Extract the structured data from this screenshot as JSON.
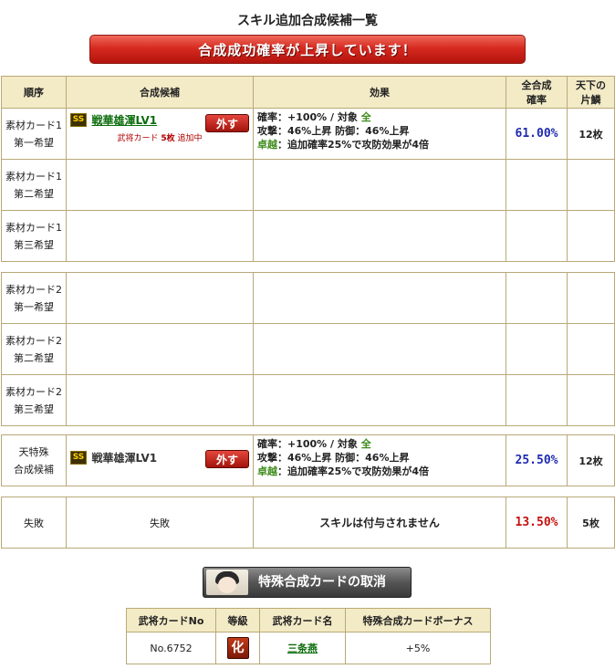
{
  "page_title": "スキル追加合成候補一覧",
  "banner": "合成成功確率が上昇しています！",
  "headers": {
    "order": "順序",
    "candidate": "合成候補",
    "effect": "効果",
    "total_rate": [
      "全合成",
      "確率"
    ],
    "count": [
      "天下の",
      "片鱗"
    ]
  },
  "group1": [
    {
      "order": [
        "素材カード1",
        "第一希望"
      ],
      "ss_badge": "SS",
      "skill_name": "戦華雄渾LV1",
      "remove_label": "外す",
      "note_prefix": "武将カード",
      "note_count": "5枚",
      "note_suffix": "追加中",
      "effect": {
        "line1_prefix": "確率：+100% / 対象",
        "line1_target": "全",
        "line2": "攻撃：46%上昇 防御：46%上昇",
        "line3_label": "卓越",
        "line3_text": "：追加確率25%で攻防効果が4倍"
      },
      "rate": "61.00%",
      "count": "12枚"
    },
    {
      "order": [
        "素材カード1",
        "第二希望"
      ]
    },
    {
      "order": [
        "素材カード1",
        "第三希望"
      ]
    }
  ],
  "group2": [
    {
      "order": [
        "素材カード2",
        "第一希望"
      ]
    },
    {
      "order": [
        "素材カード2",
        "第二希望"
      ]
    },
    {
      "order": [
        "素材カード2",
        "第三希望"
      ]
    }
  ],
  "tentokushu": {
    "order": [
      "天特殊",
      "合成候補"
    ],
    "ss_badge": "SS",
    "skill_name": "戦華雄渾LV1",
    "remove_label": "外す",
    "effect": {
      "line1_prefix": "確率：+100% / 対象",
      "line1_target": "全",
      "line2": "攻撃：46%上昇 防御：46%上昇",
      "line3_label": "卓越",
      "line3_text": "：追加確率25%で攻防効果が4倍"
    },
    "rate": "25.50%",
    "count": "12枚"
  },
  "failure": {
    "order": "失敗",
    "candidate": "失敗",
    "effect": "スキルは付与されません",
    "rate": "13.50%",
    "count": "5枚"
  },
  "cancel_button": "特殊合成カードの取消",
  "special_table": {
    "headers": [
      "武将カードNo",
      "等級",
      "武将カード名",
      "特殊合成カードボーナス"
    ],
    "row": {
      "no": "No.6752",
      "rank": "化",
      "name": "三条燕",
      "bonus": "+5%"
    }
  },
  "colors": {
    "banner_red": "#d62a20",
    "rate_blue": "#1f2bb0",
    "rate_red": "#c41010",
    "header_bg": "#f3ebc6",
    "border": "#b9a978"
  }
}
